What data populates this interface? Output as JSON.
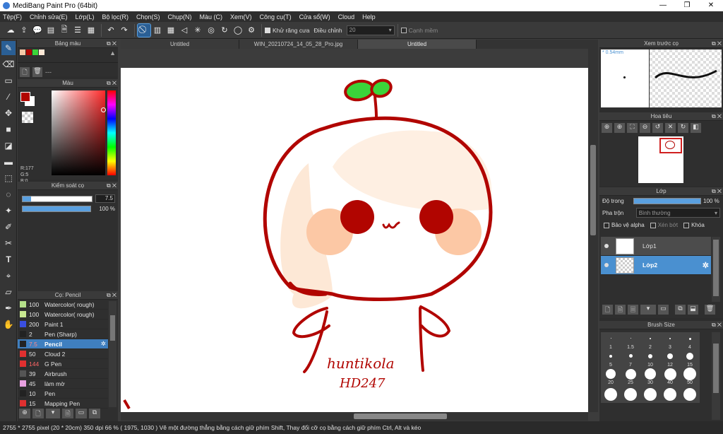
{
  "window": {
    "title": "MediBang Paint Pro (64bit)",
    "minimize": "—",
    "maximize": "❐",
    "close": "✕"
  },
  "menu": [
    "Tệp(F)",
    "Chỉnh sửa(E)",
    "Lớp(L)",
    "Bộ lọc(R)",
    "Chọn(S)",
    "Chụp(N)",
    "Màu (C)",
    "Xem(V)",
    "Công cụ(T)",
    "Cửa sổ(W)",
    "Cloud",
    "Help"
  ],
  "toolbar": {
    "antialias_label": "Khử răng cưa",
    "adjust_label": "Điều chỉnh",
    "adjust_value": "20",
    "snap_label": "Cạnh mềm"
  },
  "tabs": [
    {
      "label": "Untitled",
      "active": false
    },
    {
      "label": "WIN_20210724_14_05_28_Pro.jpg",
      "active": false
    },
    {
      "label": "Untitled",
      "active": true
    }
  ],
  "left": {
    "palette_title": "Bảng màu",
    "palette_name": "---",
    "color_title": "Màu",
    "rgb": {
      "r": "R:177",
      "g": "G:5",
      "b": "B:0"
    },
    "hex": "#B10500",
    "brush_control_title": "Kiểm soát cọ",
    "brush_size": "7.5",
    "brush_opacity": "100 %",
    "brush_list_title": "Cọ: Pencil",
    "brushes": [
      {
        "size": "100",
        "name": "Watercolor( rough)",
        "color": "#b5e08a",
        "selected": false
      },
      {
        "size": "100",
        "name": "Watercolor( rough)",
        "color": "#c8e890",
        "selected": false
      },
      {
        "size": "200",
        "name": "Paint 1",
        "color": "#3a4fe0",
        "selected": false
      },
      {
        "size": "2",
        "name": "Pen (Sharp)",
        "color": "#222222",
        "selected": false
      },
      {
        "size": "7.5",
        "name": "Pencil",
        "color": "#222222",
        "selected": true
      },
      {
        "size": "50",
        "name": "Cloud 2",
        "color": "#e03030",
        "selected": false
      },
      {
        "size": "144",
        "name": "G Pen",
        "color": "#e03030",
        "selected": false
      },
      {
        "size": "39",
        "name": "Airbrush",
        "color": "#555555",
        "selected": false
      },
      {
        "size": "45",
        "name": "làm mờ",
        "color": "#e8a0e0",
        "selected": false
      },
      {
        "size": "10",
        "name": "Pen",
        "color": "#222222",
        "selected": false
      },
      {
        "size": "15",
        "name": "Mapping Pen",
        "color": "#e03030",
        "selected": false
      }
    ]
  },
  "right": {
    "preview_title": "Xem trước cọ",
    "preview_size": "* 0.54mm",
    "navigator_title": "Hoa tiêu",
    "layer_title": "Lớp",
    "opacity_label": "Độ trong",
    "opacity_value": "100 %",
    "blend_label": "Pha trộn",
    "blend_value": "Bình thường",
    "protect_alpha": "Bảo vệ alpha",
    "clipping": "Xén bớt",
    "lock": "Khóa",
    "layers": [
      {
        "name": "Lớp1",
        "selected": false
      },
      {
        "name": "Lớp2",
        "selected": true
      }
    ],
    "brush_size_title": "Brush Size",
    "brush_sizes": [
      "1",
      "1.5",
      "2",
      "3",
      "4",
      "5",
      "7",
      "10",
      "12",
      "15",
      "20",
      "25",
      "30",
      "40",
      "50"
    ]
  },
  "canvas_signature": "huntikola",
  "canvas_signature2": "HD247",
  "status": "2755 * 2755 pixel  (20 * 20cm)  350 dpi  66 %  ( 1975, 1030 )  Vẽ một đường thẳng bằng cách giữ phím Shift, Thay đổi cỡ cọ bằng cách giữ phím Ctrl, Alt và kéo",
  "colors": {
    "accent": "#4a90d0",
    "stroke": "#b10500"
  }
}
